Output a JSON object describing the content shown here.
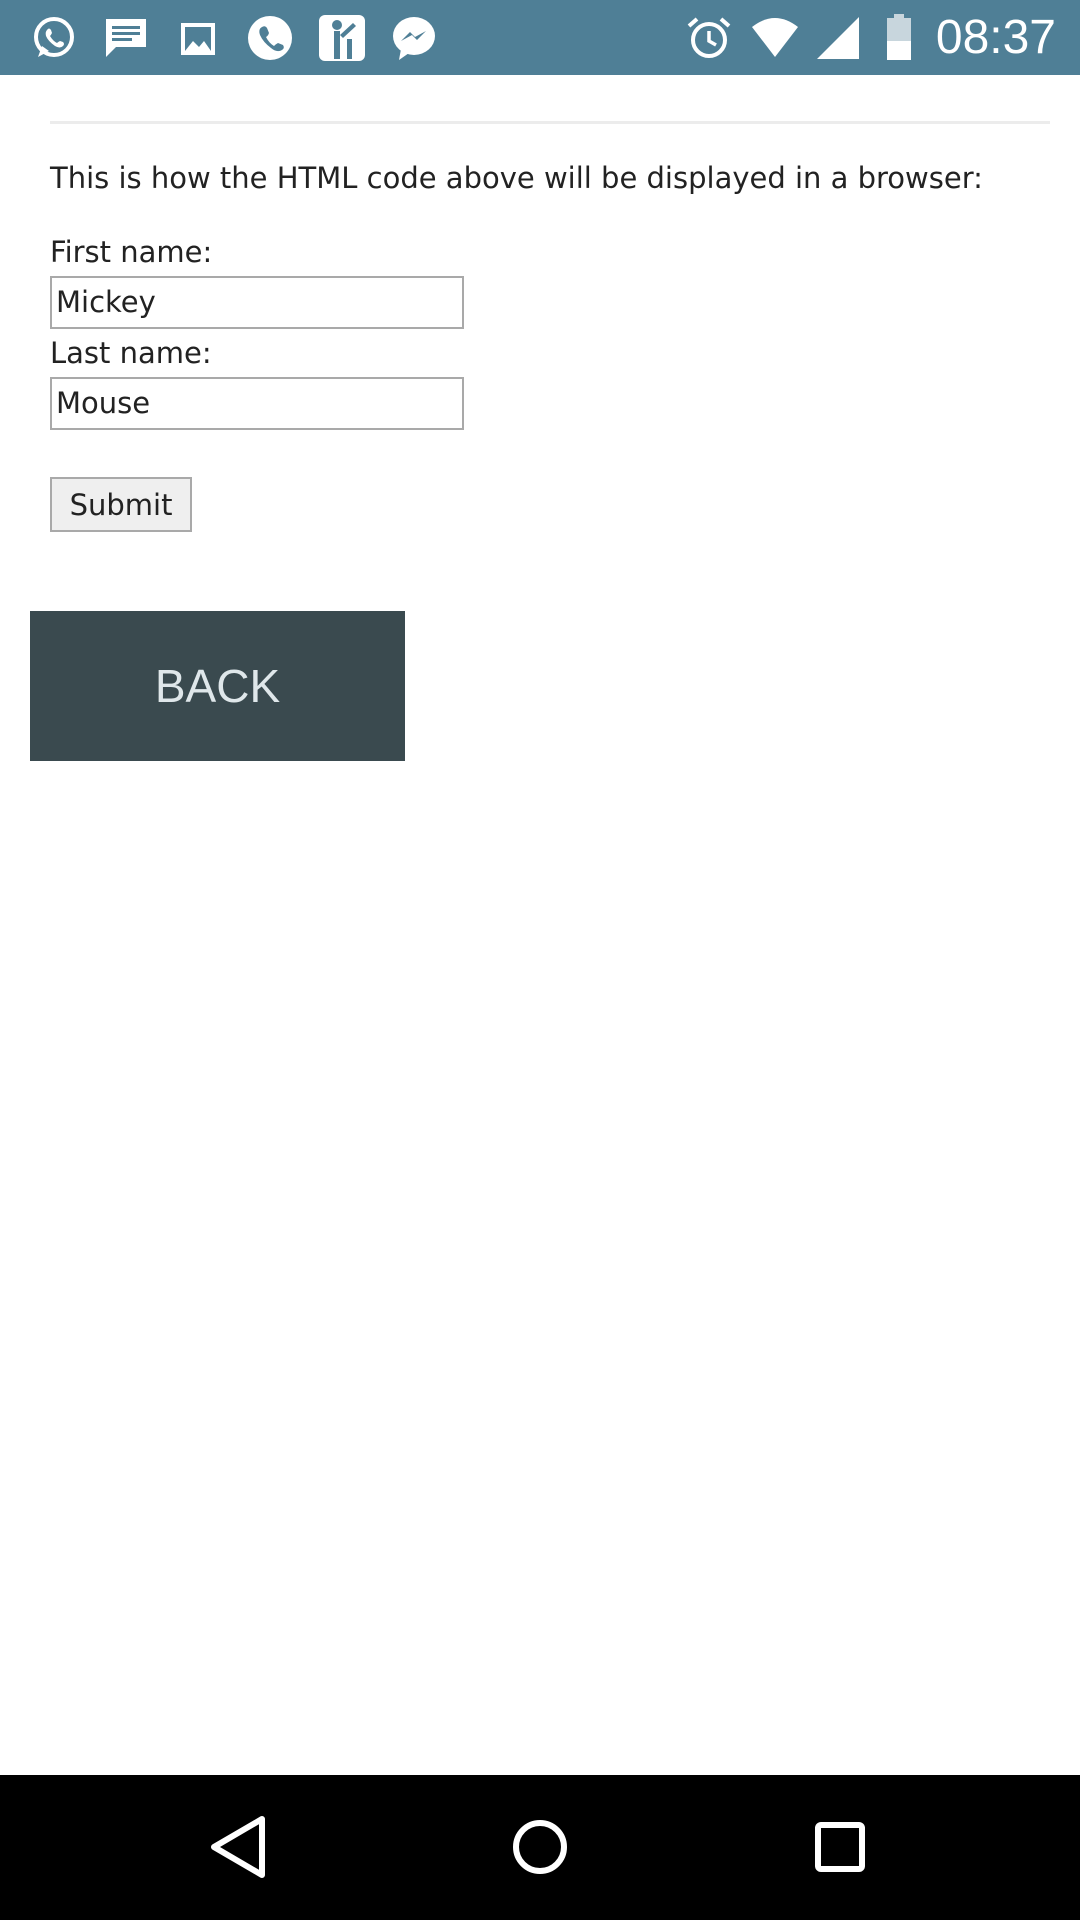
{
  "status_bar": {
    "notification_icons": [
      "whatsapp-icon",
      "message-icon",
      "gallery-icon",
      "phone-icon",
      "stickman-icon",
      "messenger-icon"
    ],
    "system_icons": [
      "alarm-icon",
      "wifi-icon",
      "signal-icon",
      "battery-icon"
    ],
    "time": "08:37"
  },
  "page": {
    "intro": "This is how the HTML code above will be displayed in a browser:",
    "form": {
      "first_name_label": "First name:",
      "first_name_value": "Mickey",
      "last_name_label": "Last name:",
      "last_name_value": "Mouse",
      "submit_label": "Submit"
    },
    "back_label": "BACK"
  },
  "nav_bar": {
    "buttons": [
      "back-icon",
      "home-icon",
      "recents-icon"
    ]
  },
  "colors": {
    "status_bar": "#4f7f96",
    "back_button": "#3a4a4f",
    "nav_bar": "#000000"
  }
}
